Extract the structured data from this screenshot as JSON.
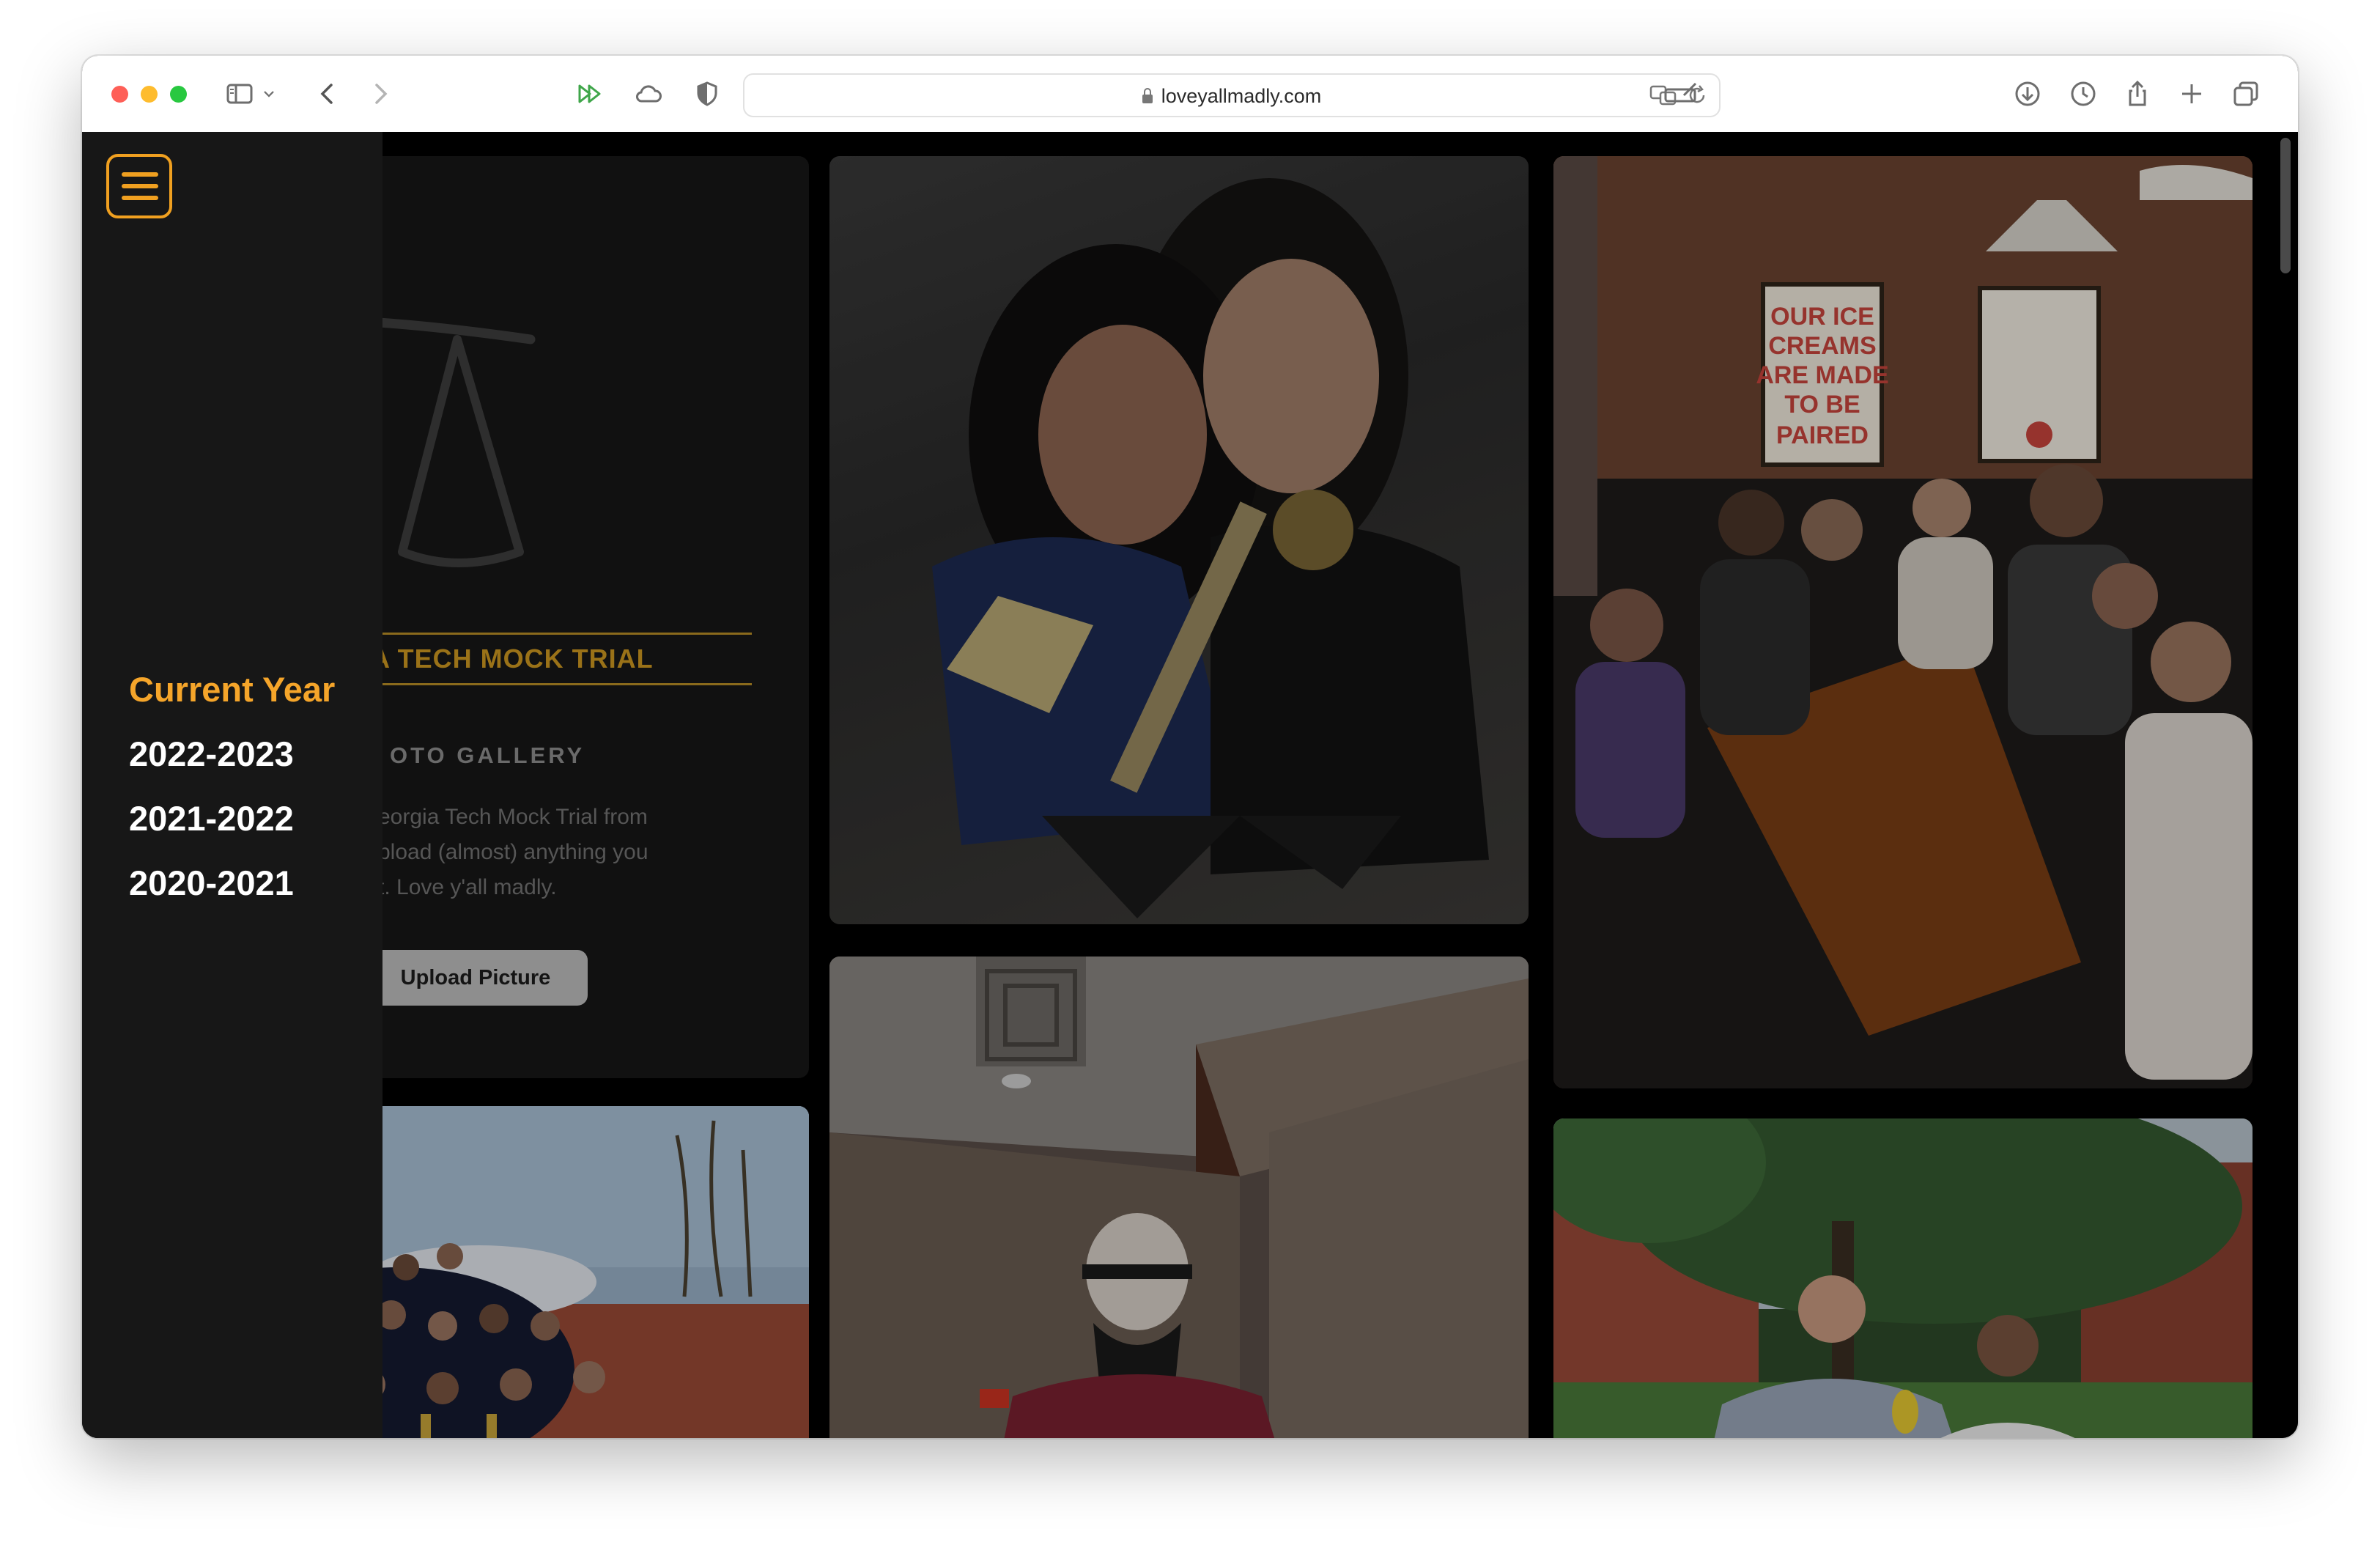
{
  "browser": {
    "url": "loveyallmadly.com",
    "traffic_lights": {
      "close": "#fe5f57",
      "minimize": "#febc2e",
      "zoom": "#28c840"
    }
  },
  "sidebar": {
    "active_color": "#f5a52a",
    "items": [
      {
        "label": "Current Year",
        "active": true
      },
      {
        "label": "2022-2023"
      },
      {
        "label": "2021-2022"
      },
      {
        "label": "2020-2021"
      }
    ]
  },
  "hero": {
    "title": "A TECH MOCK TRIAL",
    "subtitle": "OTO GALLERY",
    "description_lines": [
      "eorgia Tech Mock Trial from",
      "pload (almost) anything you",
      "t. Love y'all madly."
    ],
    "upload_label": "Upload Picture"
  },
  "photos": [
    {
      "id": "two-girls-trophy"
    },
    {
      "id": "group-ice-cream"
    },
    {
      "id": "group-outdoor"
    },
    {
      "id": "masked-person-hallway"
    },
    {
      "id": "campus-students"
    }
  ]
}
